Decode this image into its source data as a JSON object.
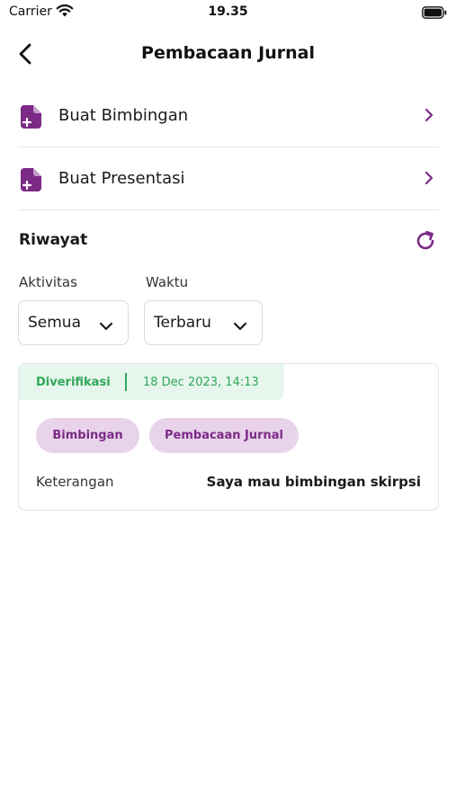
{
  "status_bar": {
    "carrier": "Carrier",
    "time": "19.35",
    "wifi_icon": "wifi-icon",
    "battery_icon": "battery-icon"
  },
  "nav": {
    "title": "Pembacaan Jurnal",
    "back_icon": "chevron-left-icon"
  },
  "menu": [
    {
      "label": "Buat Bimbingan",
      "icon": "document-add-icon"
    },
    {
      "label": "Buat Presentasi",
      "icon": "document-add-icon"
    }
  ],
  "history": {
    "title": "Riwayat",
    "refresh_icon": "refresh-icon",
    "filters": {
      "activity_label": "Aktivitas",
      "activity_value": "Semua",
      "time_label": "Waktu",
      "time_value": "Terbaru"
    },
    "items": [
      {
        "status": "Diverifikasi",
        "date": "18 Dec 2023, 14:13",
        "tags": [
          "Bimbingan",
          "Pembacaan Jurnal"
        ],
        "description_label": "Keterangan",
        "description_value": "Saya mau bimbingan skirpsi"
      }
    ]
  },
  "colors": {
    "accent": "#7b2a86",
    "chip_bg": "#e8d3ea",
    "status_green": "#2fa85a",
    "status_green_bg": "#e6f6ec"
  }
}
